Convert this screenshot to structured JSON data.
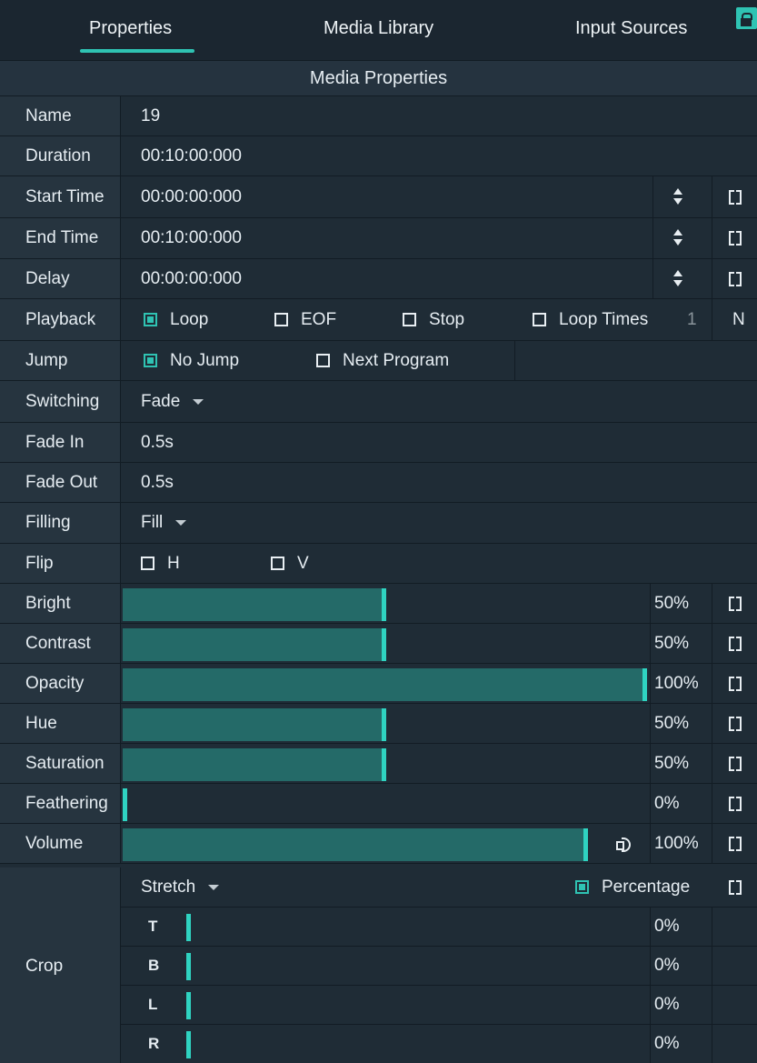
{
  "tabs": [
    "Properties",
    "Media Library",
    "Input Sources"
  ],
  "active_tab": "Properties",
  "section_title": "Media Properties",
  "fields": {
    "name": {
      "label": "Name",
      "value": "19"
    },
    "duration": {
      "label": "Duration",
      "value": "00:10:00:000"
    },
    "start_time": {
      "label": "Start Time",
      "value": "00:00:00:000"
    },
    "end_time": {
      "label": "End Time",
      "value": "00:10:00:000"
    },
    "delay": {
      "label": "Delay",
      "value": "00:00:00:000"
    }
  },
  "playback": {
    "label": "Playback",
    "options": [
      {
        "label": "Loop",
        "checked": true
      },
      {
        "label": "EOF",
        "checked": false
      },
      {
        "label": "Stop",
        "checked": false
      },
      {
        "label": "Loop Times",
        "checked": false
      }
    ],
    "loop_times_value": "1",
    "trailing": "N"
  },
  "jump": {
    "label": "Jump",
    "options": [
      {
        "label": "No Jump",
        "checked": true
      },
      {
        "label": "Next Program",
        "checked": false
      }
    ]
  },
  "switching": {
    "label": "Switching",
    "value": "Fade"
  },
  "fade_in": {
    "label": "Fade In",
    "value": "0.5s"
  },
  "fade_out": {
    "label": "Fade Out",
    "value": "0.5s"
  },
  "filling": {
    "label": "Filling",
    "value": "Fill"
  },
  "flip": {
    "label": "Flip",
    "h_label": "H",
    "v_label": "V",
    "h_checked": false,
    "v_checked": false
  },
  "sliders": [
    {
      "label": "Bright",
      "value_text": "50%",
      "fraction": 0.5
    },
    {
      "label": "Contrast",
      "value_text": "50%",
      "fraction": 0.5
    },
    {
      "label": "Opacity",
      "value_text": "100%",
      "fraction": 1.0
    },
    {
      "label": "Hue",
      "value_text": "50%",
      "fraction": 0.5
    },
    {
      "label": "Saturation",
      "value_text": "50%",
      "fraction": 0.5
    },
    {
      "label": "Feathering",
      "value_text": "0%",
      "fraction": 0.0
    },
    {
      "label": "Volume",
      "value_text": "100%",
      "fraction": 1.0
    }
  ],
  "crop": {
    "label": "Crop",
    "mode": "Stretch",
    "percentage_label": "Percentage",
    "percentage_checked": true,
    "sides": [
      {
        "letter": "T",
        "value_text": "0%"
      },
      {
        "letter": "B",
        "value_text": "0%"
      },
      {
        "letter": "L",
        "value_text": "0%"
      },
      {
        "letter": "R",
        "value_text": "0%"
      }
    ]
  },
  "colors": {
    "accent": "#2fc3b3",
    "bar_fill": "#246a68",
    "background": "#1f2c36"
  }
}
